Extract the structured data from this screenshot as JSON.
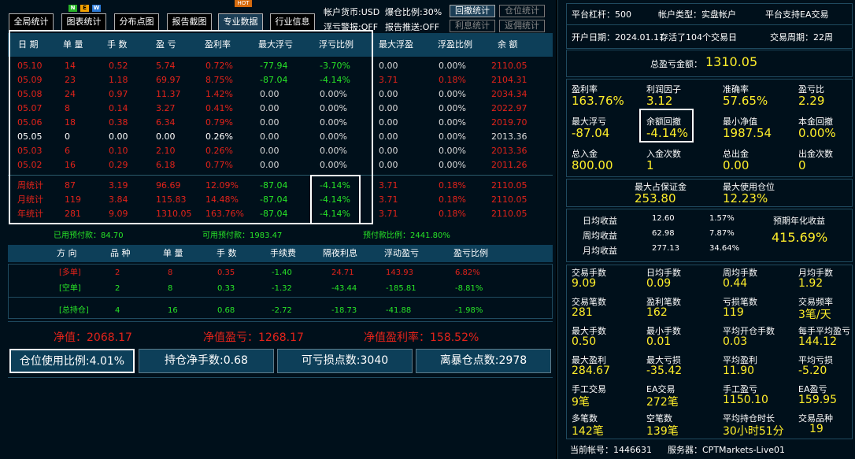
{
  "tabs": [
    {
      "label": "全局统计"
    },
    {
      "label": "图表统计"
    },
    {
      "label": "分布点图"
    },
    {
      "label": "报告截图"
    },
    {
      "label": "专业数据"
    },
    {
      "label": "行业信息"
    }
  ],
  "badges": {
    "n": "N",
    "e": "E",
    "w": "W",
    "hot": "HOT"
  },
  "top_info": {
    "currency": "帐户货币:USD",
    "burst": "爆仓比例:30%",
    "float_alert": "浮亏警报:OFF",
    "report_push": "报告推送:OFF"
  },
  "top_buttons": {
    "drawdown": "回撤统计",
    "position": "仓位统计",
    "interest": "利息统计",
    "rebate": "返佣统计"
  },
  "table": {
    "headers": [
      "日 期",
      "单 量",
      "手 数",
      "盈 亏",
      "盈利率",
      "最大浮亏",
      "浮亏比例",
      "最大浮盈",
      "浮盈比例",
      "余 额"
    ],
    "rows": [
      [
        "05.10",
        "14",
        "0.52",
        "5.74",
        "0.72%",
        "-77.94",
        "-3.70%",
        "0.00",
        "0.00%",
        "2110.05"
      ],
      [
        "05.09",
        "23",
        "1.18",
        "69.97",
        "8.75%",
        "-87.04",
        "-4.14%",
        "3.71",
        "0.18%",
        "2104.31"
      ],
      [
        "05.08",
        "24",
        "0.97",
        "11.37",
        "1.42%",
        "0.00",
        "0.00%",
        "0.00",
        "0.00%",
        "2034.34"
      ],
      [
        "05.07",
        "8",
        "0.14",
        "3.27",
        "0.41%",
        "0.00",
        "0.00%",
        "0.00",
        "0.00%",
        "2022.97"
      ],
      [
        "05.06",
        "18",
        "0.38",
        "6.34",
        "0.79%",
        "0.00",
        "0.00%",
        "0.00",
        "0.00%",
        "2019.70"
      ],
      [
        "05.05",
        "0",
        "0.00",
        "0.00",
        "0.26%",
        "0.00",
        "0.00%",
        "0.00",
        "0.00%",
        "2013.36"
      ],
      [
        "05.03",
        "6",
        "0.10",
        "2.10",
        "0.26%",
        "0.00",
        "0.00%",
        "0.00",
        "0.00%",
        "2013.36"
      ],
      [
        "05.02",
        "16",
        "0.29",
        "6.18",
        "0.77%",
        "0.00",
        "0.00%",
        "0.00",
        "0.00%",
        "2011.26"
      ]
    ],
    "row_colors": [
      "red",
      "red",
      "red",
      "red",
      "red",
      "white",
      "red",
      "red"
    ],
    "summary": [
      [
        "周统计",
        "87",
        "3.19",
        "96.69",
        "12.09%",
        "-87.04",
        "-4.14%",
        "3.71",
        "0.18%",
        "2110.05"
      ],
      [
        "月统计",
        "119",
        "3.84",
        "115.83",
        "14.48%",
        "-87.04",
        "-4.14%",
        "3.71",
        "0.18%",
        "2110.05"
      ],
      [
        "年统计",
        "281",
        "9.09",
        "1310.05",
        "163.76%",
        "-87.04",
        "-4.14%",
        "3.71",
        "0.18%",
        "2110.05"
      ]
    ]
  },
  "prepay": {
    "used": "已用预付款：84.70",
    "available": "可用预付款：1983.47",
    "ratio": "预付款比例：2441.80%"
  },
  "positions": {
    "headers": [
      "方 向",
      "品 种",
      "单 量",
      "手 数",
      "手续费",
      "隔夜利息",
      "浮动盈亏",
      "盈亏比例"
    ],
    "rows": [
      [
        "[多单]",
        "2",
        "8",
        "0.35",
        "-1.40",
        "24.71",
        "143.93",
        "6.82%"
      ],
      [
        "[空单]",
        "2",
        "8",
        "0.33",
        "-1.32",
        "-43.44",
        "-185.81",
        "-8.81%"
      ],
      [
        "[总持仓]",
        "4",
        "16",
        "0.68",
        "-2.72",
        "-18.73",
        "-41.88",
        "-1.98%"
      ]
    ]
  },
  "net": {
    "equity": "净值：2068.17",
    "equity_pl": "净值盈亏：1268.17",
    "equity_rate": "净值盈利率：158.52%"
  },
  "bottom_buttons": [
    "仓位使用比例:4.01%",
    "持仓净手数:0.68",
    "可亏损点数:3040",
    "离暴仓点数:2978"
  ],
  "right": {
    "row1": [
      "平台杠杆：500",
      "帐户类型：实盘帐户",
      "平台支持EA交易"
    ],
    "row2": [
      "开户日期：2024.01.11",
      "存活了104个交易日",
      "交易周期：22周"
    ],
    "total_label": "总盈亏金额：",
    "total_value": "1310.05",
    "g1": [
      {
        "label": "盈利率",
        "value": "163.76%"
      },
      {
        "label": "利润因子",
        "value": "3.12"
      },
      {
        "label": "准确率",
        "value": "57.65%"
      },
      {
        "label": "盈亏比",
        "value": "2.29"
      },
      {
        "label": "最大浮亏",
        "value": "-87.04"
      },
      {
        "label": "余额回撤",
        "value": "-4.14%"
      },
      {
        "label": "最小净值",
        "value": "1987.54"
      },
      {
        "label": "本金回撤",
        "value": "0.00%"
      },
      {
        "label": "总入金",
        "value": "800.00"
      },
      {
        "label": "入金次数",
        "value": "1"
      },
      {
        "label": "总出金",
        "value": "0.00"
      },
      {
        "label": "出金次数",
        "value": "0"
      }
    ],
    "margin": [
      {
        "label": "最大占保证金",
        "value": "253.80"
      },
      {
        "label": "最大使用仓位",
        "value": "12.23%"
      }
    ],
    "daily": [
      [
        "日均收益",
        "12.60",
        "1.57%"
      ],
      [
        "周均收益",
        "62.98",
        "7.87%"
      ],
      [
        "月均收益",
        "277.13",
        "34.64%"
      ]
    ],
    "annual_label": "预期年化收益",
    "annual_value": "415.69%",
    "g2": [
      {
        "label": "交易手数",
        "value": "9.09"
      },
      {
        "label": "日均手数",
        "value": "0.09"
      },
      {
        "label": "周均手数",
        "value": "0.44"
      },
      {
        "label": "月均手数",
        "value": "1.92"
      },
      {
        "label": "交易笔数",
        "value": "281"
      },
      {
        "label": "盈利笔数",
        "value": "162"
      },
      {
        "label": "亏损笔数",
        "value": "119"
      },
      {
        "label": "交易频率",
        "value": "3笔/天"
      },
      {
        "label": "最大手数",
        "value": "0.50"
      },
      {
        "label": "最小手数",
        "value": "0.01"
      },
      {
        "label": "平均开仓手数",
        "value": "0.03"
      },
      {
        "label": "每手平均盈亏",
        "value": "144.12"
      },
      {
        "label": "最大盈利",
        "value": "284.67"
      },
      {
        "label": "最大亏损",
        "value": "-35.42"
      },
      {
        "label": "平均盈利",
        "value": "11.90"
      },
      {
        "label": "平均亏损",
        "value": "-5.20"
      },
      {
        "label": "手工交易",
        "value": "9笔"
      },
      {
        "label": "EA交易",
        "value": "272笔"
      },
      {
        "label": "手工盈亏",
        "value": "1150.10"
      },
      {
        "label": "EA盈亏",
        "value": "159.95"
      },
      {
        "label": "多笔数",
        "value": "142笔"
      },
      {
        "label": "空笔数",
        "value": "139笔"
      },
      {
        "label": "平均持仓时长",
        "value": "30小时51分"
      },
      {
        "label": "交易品种",
        "value": "19"
      }
    ],
    "account": "当前帐号：1446631",
    "server": "服务器：CPTMarkets-Live01"
  }
}
